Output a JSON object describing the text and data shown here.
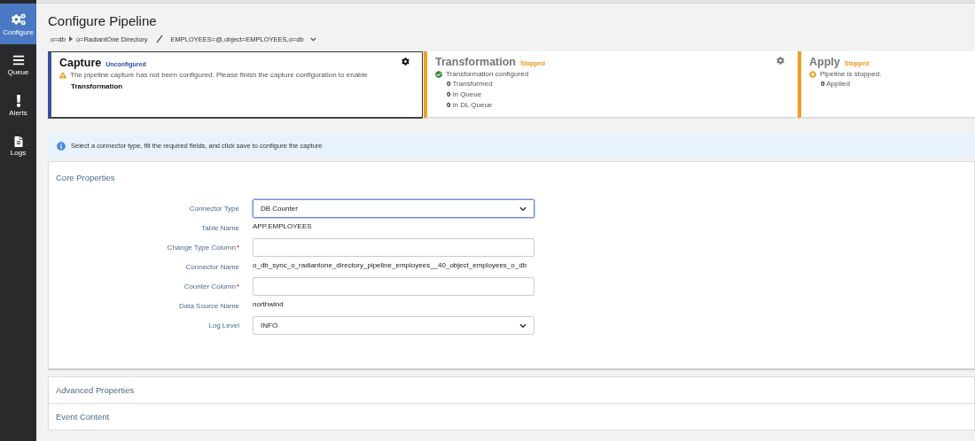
{
  "sidebar": {
    "items": [
      {
        "label": "Configure",
        "kind": "gears",
        "selected": true
      },
      {
        "label": "Queue",
        "kind": "menu",
        "selected": false
      },
      {
        "label": "Alerts",
        "kind": "alert",
        "selected": false
      },
      {
        "label": "Logs",
        "kind": "document",
        "selected": false
      }
    ]
  },
  "page": {
    "title": "Configure Pipeline",
    "breadcrumb": [
      "o=db",
      "o=RadiantOne Directory"
    ],
    "breadcrumb_target": "EMPLOYEES=@,object=EMPLOYEES,o=db"
  },
  "stages": [
    {
      "title": "Capture",
      "status": {
        "text": "Unconfigured",
        "color": "#2b4aa8"
      },
      "selected": true,
      "settings": true,
      "message": {
        "kind": "warning",
        "text": "The pipeline capture has not been configured. Please finish the capture configuration to enable"
      },
      "message_bold": "Transformation"
    },
    {
      "title": "Transformation",
      "status": {
        "text": "Stopped",
        "color": "#e89a1a"
      },
      "selected": false,
      "settings": true,
      "message": {
        "kind": "ok",
        "text": "Transformation configured"
      },
      "counts": [
        "**0** Transformed",
        "**0** in Queue",
        "**0** in DL Queue"
      ]
    },
    {
      "title": "Apply",
      "status": {
        "text": "Stopped",
        "color": "#e89a1a"
      },
      "selected": false,
      "settings": false,
      "message": {
        "kind": "stopped",
        "text": "Pipeline is stopped."
      },
      "counts": [
        "**0** Applied"
      ]
    }
  ],
  "info": "Select a connector type, fill the required fields, and click save to configure the capture",
  "core": {
    "title": "Core Properties",
    "fields": [
      {
        "kind": "select",
        "label": "Connector Type",
        "value": "DB Counter",
        "focused": true
      },
      {
        "kind": "text",
        "label": "Table Name",
        "value": "APP.EMPLOYEES"
      },
      {
        "kind": "input",
        "label": "Change Type Column",
        "required_mark": "*"
      },
      {
        "kind": "text",
        "label": "Connector Name",
        "value": "o_db_sync_o_radiantone_directory_pipeline_employees__40_object_employees_o_db"
      },
      {
        "kind": "input",
        "label": "Counter Column",
        "required_mark": "*"
      },
      {
        "kind": "text",
        "label": "Data Source Name",
        "value": "northwind"
      },
      {
        "kind": "select",
        "label": "Log Level",
        "value": "INFO",
        "focused": false
      }
    ]
  },
  "sections": [
    "Advanced Properties",
    "Event Content"
  ]
}
